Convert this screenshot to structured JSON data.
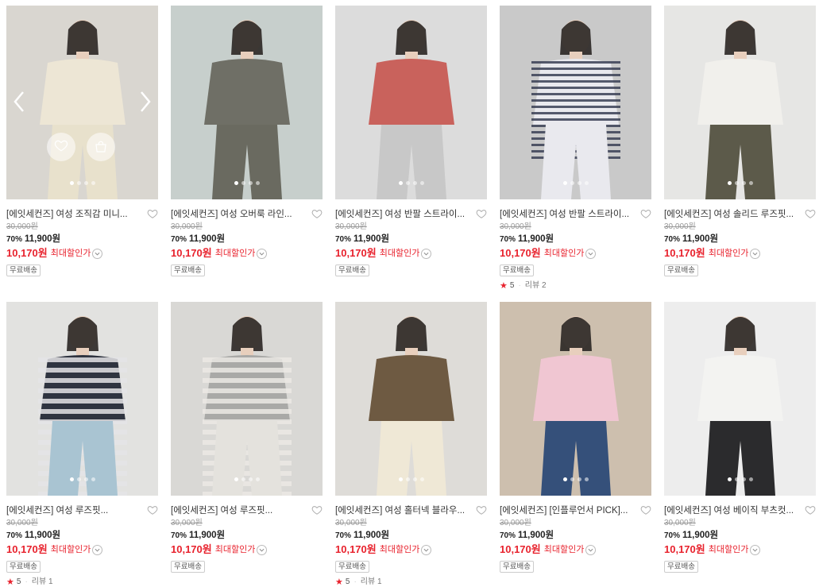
{
  "products": [
    {
      "title": "[에잇세컨즈] 여성 조직감 미니...",
      "orig": "30,000원",
      "disc": "70%",
      "price": "11,900원",
      "max_price": "10,170원",
      "max_label": "최대할인가",
      "badge": "무료배송",
      "bg": "#d9d6d0",
      "shirt": "#ede6d5",
      "pants": "#e8e1cc",
      "review": null
    },
    {
      "title": "[에잇세컨즈] 여성 오버룩 라인...",
      "orig": "30,000원",
      "disc": "70%",
      "price": "11,900원",
      "max_price": "10,170원",
      "max_label": "최대할인가",
      "badge": "무료배송",
      "bg": "#c7cfcc",
      "shirt": "#6f6f66",
      "pants": "#6a6a60",
      "review": null
    },
    {
      "title": "[에잇세컨즈] 여성 반팔 스트라이...",
      "orig": "30,000원",
      "disc": "70%",
      "price": "11,900원",
      "max_price": "10,170원",
      "max_label": "최대할인가",
      "badge": "무료배송",
      "bg": "#dcdcdc",
      "shirt": "#c9625c",
      "pants": "#c8c8c8",
      "review": null
    },
    {
      "title": "[에잇세컨즈] 여성 반팔 스트라이...",
      "orig": "30,000원",
      "disc": "70%",
      "price": "11,900원",
      "max_price": "10,170원",
      "max_label": "최대할인가",
      "badge": "무료배송",
      "bg": "#c9c9c9",
      "shirt": "#e9e9ee",
      "pants": "#e9e9ee",
      "review": {
        "score": "5",
        "text": "리뷰 2"
      }
    },
    {
      "title": "[에잇세컨즈] 여성 솔리드 루즈핏...",
      "orig": "30,000원",
      "disc": "70%",
      "price": "11,900원",
      "max_price": "10,170원",
      "max_label": "최대할인가",
      "badge": "무료배송",
      "bg": "#e6e6e4",
      "shirt": "#f1f0ec",
      "pants": "#5c5a4a",
      "review": null
    },
    {
      "title": "[에잇세컨즈] 여성 루즈핏...",
      "orig": "30,000원",
      "disc": "70%",
      "price": "11,900원",
      "max_price": "10,170원",
      "max_label": "최대할인가",
      "badge": "무료배송",
      "bg": "#e2e2e0",
      "shirt": "#2f3440",
      "pants": "#a9c4d2",
      "review": {
        "score": "5",
        "text": "리뷰 1"
      }
    },
    {
      "title": "[에잇세컨즈] 여성 루즈핏...",
      "orig": "30,000원",
      "disc": "70%",
      "price": "11,900원",
      "max_price": "10,170원",
      "max_label": "최대할인가",
      "badge": "무료배송",
      "bg": "#d9d8d5",
      "shirt": "#a9a9a7",
      "pants": "#e4e2dd",
      "review": null
    },
    {
      "title": "[에잇세컨즈] 여성 홀터넥 블라우...",
      "orig": "30,000원",
      "disc": "70%",
      "price": "11,900원",
      "max_price": "10,170원",
      "max_label": "최대할인가",
      "badge": "무료배송",
      "bg": "#dedcd8",
      "shirt": "#6e5a42",
      "pants": "#efe8d6",
      "review": {
        "score": "5",
        "text": "리뷰 1"
      }
    },
    {
      "title": "[에잇세컨즈] [인플루언서 PICK]...",
      "orig": "30,000원",
      "disc": "70%",
      "price": "11,900원",
      "max_price": "10,170원",
      "max_label": "최대할인가",
      "badge": "무료배송",
      "bg": "#cdbfae",
      "shirt": "#f0c6d2",
      "pants": "#35507a",
      "review": null
    },
    {
      "title": "[에잇세컨즈] 여성 베이직 부츠컷...",
      "orig": "30,000원",
      "disc": "70%",
      "price": "11,900원",
      "max_price": "10,170원",
      "max_label": "최대할인가",
      "badge": "무료배송",
      "bg": "#ededed",
      "shirt": "#f3f3f1",
      "pants": "#2b2b2d",
      "review": null
    }
  ],
  "colors": {
    "sale": "#e8222d",
    "star": "#e8222d"
  },
  "icons": {
    "heart": "heart-icon",
    "cart": "cart-icon",
    "prev": "chevron-left-icon",
    "next": "chevron-right-icon",
    "chevron_down": "chevron-down-icon"
  }
}
